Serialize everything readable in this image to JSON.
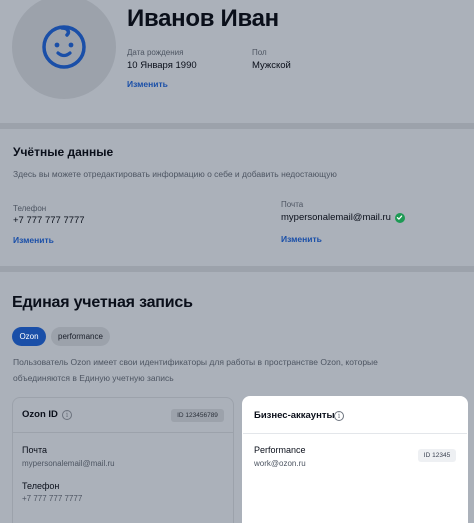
{
  "profile": {
    "name": "Иванов Иван",
    "birth_label": "Дата рождения",
    "birth_value": "10 Января 1990",
    "gender_label": "Пол",
    "gender_value": "Мужской",
    "edit_link": "Изменить"
  },
  "account": {
    "title": "Учётные данные",
    "description": "Здесь вы можете отредактировать информацию о себе и добавить недостающую",
    "phone_label": "Телефон",
    "phone_value": "+7 777 777 7777",
    "phone_edit": "Изменить",
    "email_label": "Почта",
    "email_value": "mypersonalemail@mail.ru",
    "email_edit": "Изменить"
  },
  "unified": {
    "title": "Единая учетная запись",
    "tabs": [
      {
        "label": "Ozon",
        "active": true
      },
      {
        "label": "performance",
        "active": false
      }
    ],
    "description_line1": "Пользователь Ozon имеет свои идентификаторы для работы в пространстве Ozon, которые",
    "description_line2": "объединяются в Единую учетную запись"
  },
  "ozon_card": {
    "title": "Ozon ID",
    "id_badge": "ID 123456789",
    "email_label": "Почта",
    "email_value": "mypersonalemail@mail.ru",
    "phone_label": "Телефон",
    "phone_value": "+7 777 777 7777"
  },
  "business_card": {
    "title": "Бизнес-аккаунты",
    "account_name": "Performance",
    "account_email": "work@ozon.ru",
    "id_badge": "ID 12345"
  },
  "icons": {
    "avatar": "baby-face-icon",
    "verified": "check-circle-icon",
    "info": "info-icon"
  },
  "colors": {
    "accent": "#1a4fa8",
    "verified": "#1d9a54",
    "background": "#abb1ba",
    "card_highlight": "#ffffff"
  }
}
